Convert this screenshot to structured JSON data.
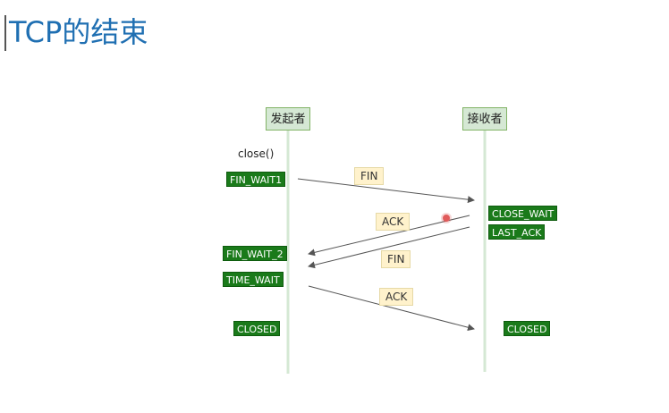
{
  "slide": {
    "title": "TCP的结束"
  },
  "actors": {
    "initiator": "发起者",
    "receiver": "接收者"
  },
  "notes": {
    "close_call": "close()"
  },
  "initiator_states": {
    "fin_wait1": "FIN_WAIT1",
    "fin_wait2": "FIN_WAIT_2",
    "time_wait": "TIME_WAIT",
    "closed": "CLOSED"
  },
  "receiver_states": {
    "close_wait": "CLOSE_WAIT",
    "last_ack": "LAST_ACK",
    "closed": "CLOSED"
  },
  "messages": {
    "fin_1": "FIN",
    "ack_1": "ACK",
    "fin_2": "FIN",
    "ack_2": "ACK"
  },
  "colors": {
    "title": "#1f6fb2",
    "actor_fill": "#d5e8d4",
    "actor_border": "#82b366",
    "state_fill": "#1a7a1a",
    "message_fill": "#fff2cc",
    "arrow": "#555555"
  }
}
